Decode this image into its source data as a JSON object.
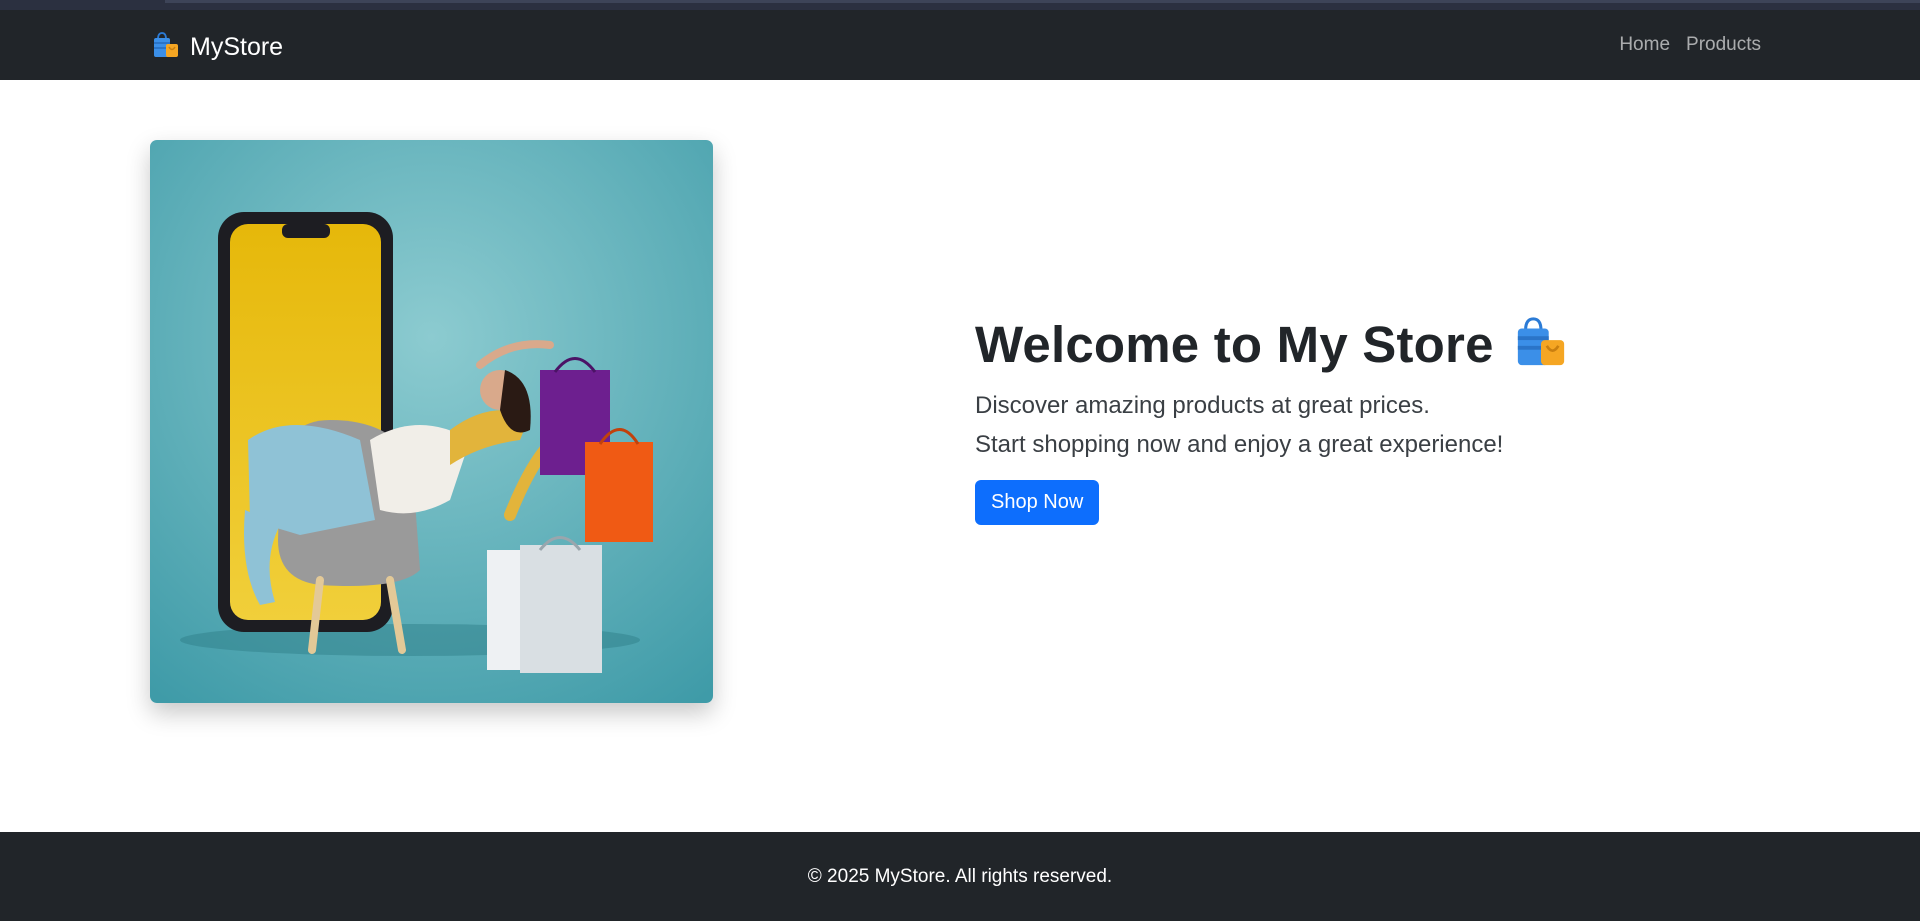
{
  "navbar": {
    "brand": "MyStore",
    "brand_icon": "shopping-bags-icon",
    "links": [
      {
        "label": "Home"
      },
      {
        "label": "Products"
      }
    ]
  },
  "hero": {
    "title": "Welcome to My Store",
    "title_icon": "shopping-bags-icon",
    "line1": "Discover amazing products at great prices.",
    "line2": "Start shopping now and enjoy a great experience!",
    "button": "Shop Now",
    "image_icon": "woman-shopping-phone-illustration"
  },
  "footer": {
    "text": "© 2025 MyStore. All rights reserved."
  },
  "colors": {
    "nav_bg": "#212529",
    "primary": "#0d6efd",
    "hero_bg": "#4fa7b2"
  }
}
